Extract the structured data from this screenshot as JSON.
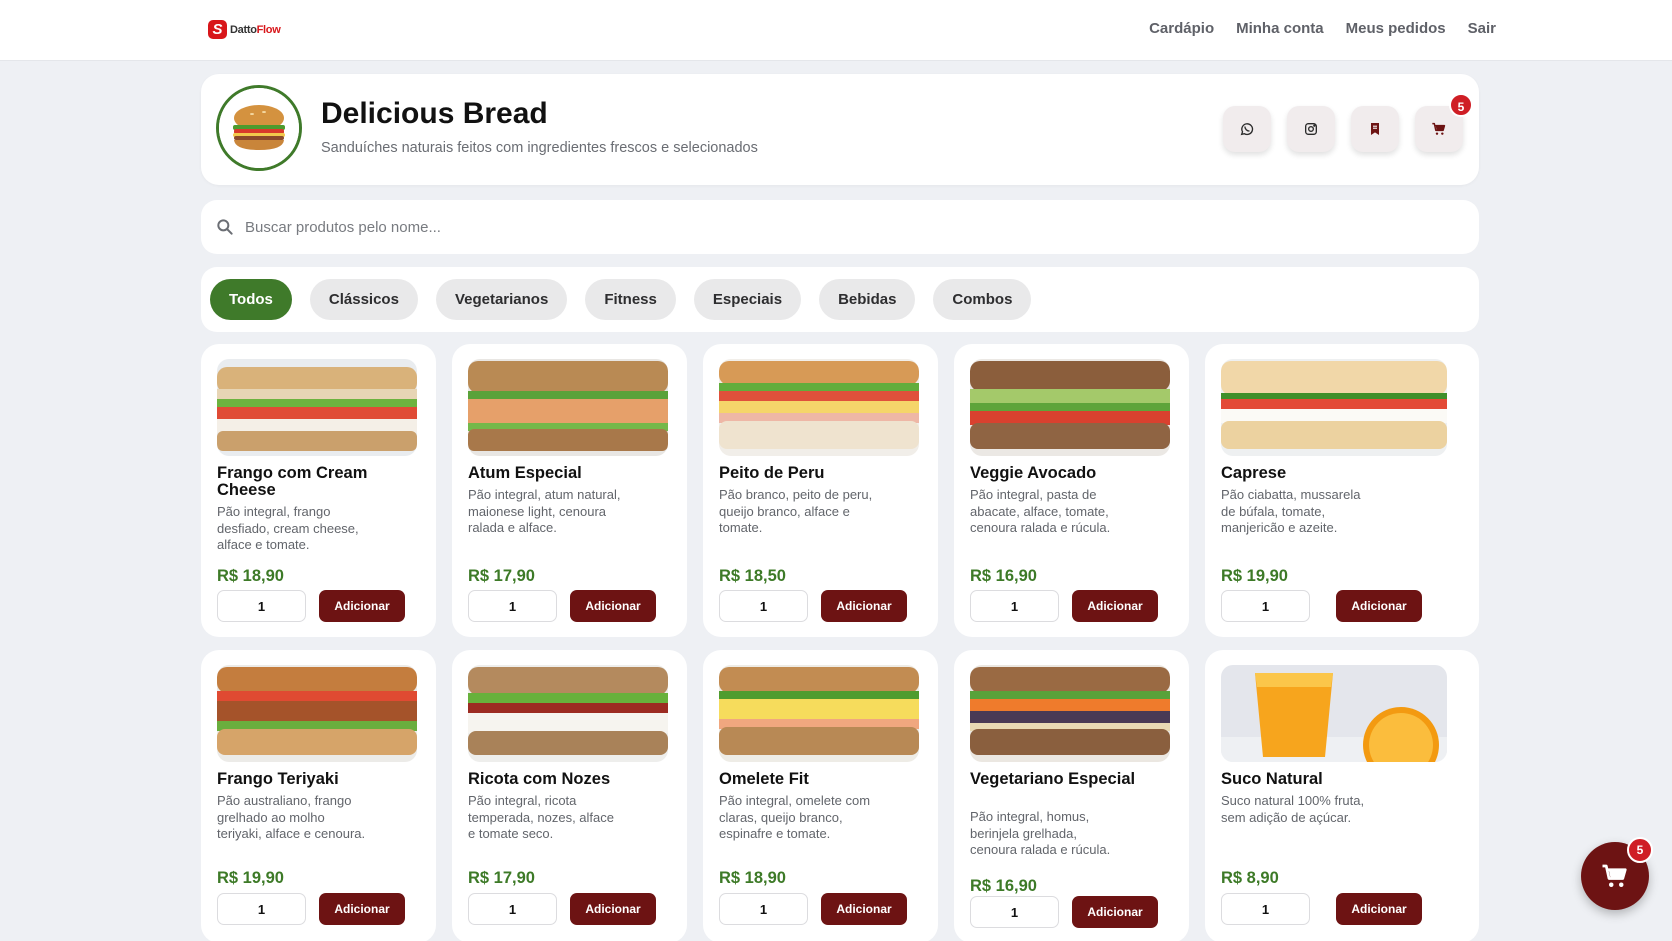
{
  "brand": {
    "name_prefix": "Datto",
    "name_suffix": "Flow",
    "mark": "S",
    "color": "#d8161a"
  },
  "nav": {
    "items": [
      "Cardápio",
      "Minha conta",
      "Meus pedidos",
      "Sair"
    ]
  },
  "store": {
    "name": "Delicious Bread",
    "tagline": "Sanduíches naturais feitos com ingredientes frescos e selecionados",
    "logo_icon": "sandwich-logo",
    "accent": "#3f7a2a"
  },
  "actions": {
    "whatsapp_icon": "whatsapp-icon",
    "instagram_icon": "instagram-icon",
    "bookmark_icon": "bookmark-icon",
    "cart_icon": "cart-icon",
    "cart_count": "5"
  },
  "search": {
    "placeholder": "Buscar produtos pelo nome..."
  },
  "categories": {
    "items": [
      "Todos",
      "Clássicos",
      "Vegetarianos",
      "Fitness",
      "Especiais",
      "Bebidas",
      "Combos"
    ],
    "active": "Todos"
  },
  "colors": {
    "primary": "#6d1313",
    "price": "#3d7a27",
    "badge": "#cf1e25"
  },
  "products": [
    {
      "name": "Frango com Cream Cheese",
      "desc": "Pão integral, frango desfiado, cream cheese, alface e tomate.",
      "price": "R$ 18,90",
      "qty": "1",
      "button": "Adicionar",
      "image": "sandwich-chicken"
    },
    {
      "name": "Atum Especial",
      "desc": "Pão integral, atum natural, maionese light, cenoura ralada e alface.",
      "price": "R$ 17,90",
      "qty": "1",
      "button": "Adicionar",
      "image": "sandwich-tuna"
    },
    {
      "name": "Peito de Peru",
      "desc": "Pão branco, peito de peru, queijo branco, alface e tomate.",
      "price": "R$ 18,50",
      "qty": "1",
      "button": "Adicionar",
      "image": "sandwich-turkey"
    },
    {
      "name": "Veggie Avocado",
      "desc": "Pão integral, pasta de abacate, alface, tomate, cenoura ralada e rúcula.",
      "price": "R$ 16,90",
      "qty": "1",
      "button": "Adicionar",
      "image": "sandwich-avocado"
    },
    {
      "name": "Caprese",
      "desc": "Pão ciabatta, mussarela de búfala, tomate, manjericão e azeite.",
      "price": "R$ 19,90",
      "qty": "1",
      "button": "Adicionar",
      "image": "sandwich-caprese"
    },
    {
      "name": "Frango Teriyaki",
      "desc": "Pão australiano, frango grelhado ao molho teriyaki, alface e cenoura.",
      "price": "R$ 19,90",
      "qty": "1",
      "button": "Adicionar",
      "image": "sandwich-teriyaki"
    },
    {
      "name": "Ricota com Nozes",
      "desc": "Pão integral, ricota temperada, nozes, alface e tomate seco.",
      "price": "R$ 17,90",
      "qty": "1",
      "button": "Adicionar",
      "image": "sandwich-ricotta"
    },
    {
      "name": "Omelete Fit",
      "desc": "Pão integral, omelete com claras, queijo branco, espinafre e tomate.",
      "price": "R$ 18,90",
      "qty": "1",
      "button": "Adicionar",
      "image": "sandwich-omelette"
    },
    {
      "name": "Vegetariano Especial",
      "desc": "Pão integral, homus, berinjela grelhada, cenoura ralada e rúcula.",
      "price": "R$ 16,90",
      "qty": "1",
      "button": "Adicionar",
      "image": "sandwich-vegetarian"
    },
    {
      "name": "Suco Natural",
      "desc": "Suco natural 100% fruta, sem adição de açúcar.",
      "price": "R$ 8,90",
      "qty": "1",
      "button": "Adicionar",
      "image": "orange-juice"
    }
  ],
  "floating_cart": {
    "icon": "cart-icon",
    "count": "5"
  }
}
